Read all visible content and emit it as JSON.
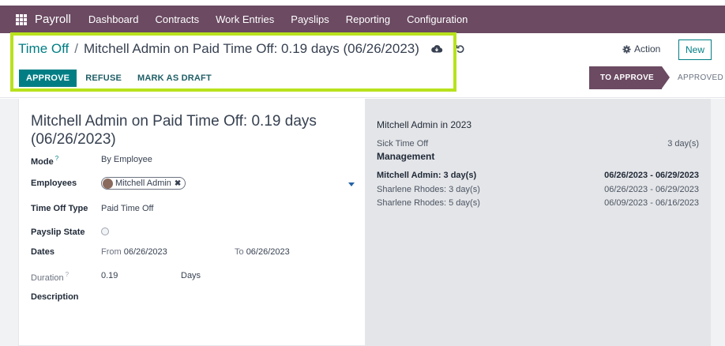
{
  "navbar": {
    "brand": "Payroll",
    "items": [
      "Dashboard",
      "Contracts",
      "Work Entries",
      "Payslips",
      "Reporting",
      "Configuration"
    ]
  },
  "breadcrumb": {
    "parent": "Time Off",
    "separator": "/",
    "current": "Mitchell Admin on Paid Time Off: 0.19 days (06/26/2023)"
  },
  "toolbar": {
    "approve": "APPROVE",
    "refuse": "REFUSE",
    "draft": "MARK AS DRAFT",
    "action": "Action",
    "new": "New"
  },
  "status": {
    "active": "TO APPROVE",
    "next": "APPROVED"
  },
  "form": {
    "title": "Mitchell Admin on Paid Time Off: 0.19 days (06/26/2023)",
    "mode_label": "Mode",
    "mode_help": "?",
    "mode_value": "By Employee",
    "employees_label": "Employees",
    "employee_tag": "Mitchell Admin",
    "type_label": "Time Off Type",
    "type_value": "Paid Time Off",
    "payslip_label": "Payslip State",
    "dates_label": "Dates",
    "from_label": "From",
    "from_value": "06/26/2023",
    "to_label": "To",
    "to_value": "06/26/2023",
    "duration_label": "Duration",
    "duration_help": "?",
    "duration_value": "0.19",
    "duration_unit": "Days",
    "description_label": "Description"
  },
  "side": {
    "heading": "Mitchell Admin in 2023",
    "sick_label": "Sick Time Off",
    "sick_value": "3 day(s)",
    "management": "Management",
    "rows": [
      {
        "who": "Mitchell Admin: 3 day(s)",
        "when": "06/26/2023 - 06/29/2023"
      },
      {
        "who": "Sharlene Rhodes: 3 day(s)",
        "when": "06/26/2023 - 06/29/2023"
      },
      {
        "who": "Sharlene Rhodes: 5 day(s)",
        "when": "06/09/2023 - 06/16/2023"
      }
    ]
  },
  "colors": {
    "nav": "#6b4a62",
    "accent": "#017e84",
    "highlight": "#b8e21d"
  }
}
